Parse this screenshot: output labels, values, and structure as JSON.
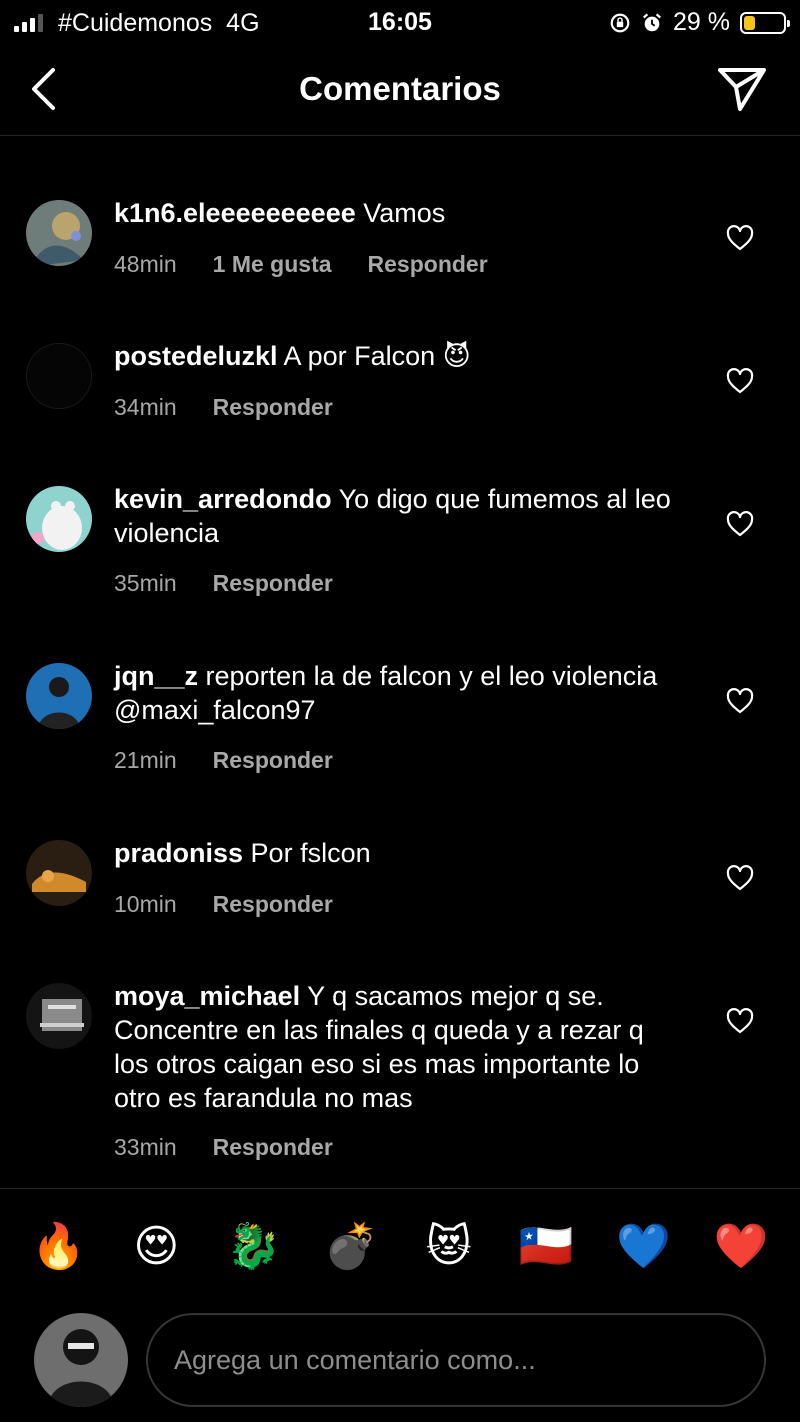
{
  "status_bar": {
    "carrier": "#Cuidemonos",
    "network": "4G",
    "time": "16:05",
    "battery_text": "29 %",
    "battery_level": 0.29
  },
  "header": {
    "title": "Comentarios",
    "back_icon": "chevron-left-icon",
    "send_icon": "paper-plane-icon"
  },
  "comments": [
    {
      "username": "k1n6.eleeeeeeeeee",
      "text": "Vamos",
      "time": "48min",
      "likes": "1 Me gusta",
      "reply": "Responder"
    },
    {
      "username": "postedeluzkl",
      "text": "A por Falcon",
      "emoji": "😈",
      "time": "34min",
      "reply": "Responder"
    },
    {
      "username": "kevin_arredondo",
      "text": "Yo digo que fumemos al leo violencia",
      "time": "35min",
      "reply": "Responder"
    },
    {
      "username": "jqn__z",
      "text": "reporten la de falcon y el leo violencia @maxi_falcon97",
      "time": "21min",
      "reply": "Responder"
    },
    {
      "username": "pradoniss",
      "text": "Por fslcon",
      "time": "10min",
      "reply": "Responder"
    },
    {
      "username": "moya_michael",
      "text": "Y q sacamos mejor q se. Concentre en las finales q queda y a rezar q los otros caigan eso si es mas importante lo otro es farandula no mas",
      "time": "33min",
      "reply": "Responder"
    }
  ],
  "emoji_bar": [
    "🔥",
    "😍",
    "🐉",
    "💣",
    "😻",
    "🇨🇱",
    "💙",
    "❤️"
  ],
  "input": {
    "placeholder": "Agrega un comentario como..."
  },
  "colors": {
    "background": "#000000",
    "meta_text": "#a8a8a8",
    "divider": "#262626",
    "battery": "#f5c518"
  }
}
